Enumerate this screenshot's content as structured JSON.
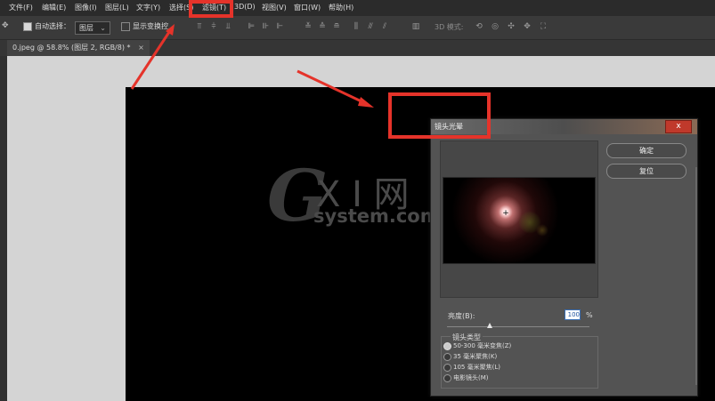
{
  "menu": {
    "items": [
      "文件(F)",
      "编辑(E)",
      "图像(I)",
      "图层(L)",
      "文字(Y)",
      "选择(S)",
      "滤镜(T)",
      "3D(D)",
      "视图(V)",
      "窗口(W)",
      "帮助(H)"
    ]
  },
  "options": {
    "auto_select_label": "自动选择：",
    "auto_select_checked": true,
    "layer_select_value": "图层",
    "show_transform_label": "显示变换控",
    "mode_3d_label": "3D 模式:"
  },
  "document": {
    "tab_title": "0.jpeg @ 58.8% (图层 2, RGB/8) *",
    "close_glyph": "×"
  },
  "watermark": {
    "logo_g": "G",
    "logo_xi": "X I 网",
    "logo_system": "system.com"
  },
  "dialog": {
    "title": "镜头光晕",
    "close_glyph": "x",
    "ok_label": "确定",
    "reset_label": "复位",
    "brightness_label": "亮度(B):",
    "brightness_value": "100",
    "brightness_unit": "%",
    "brightness_slider_fraction": 0.3,
    "lens_type_title": "镜头类型",
    "lens_types": [
      {
        "label": "50-300 毫米变焦(Z)",
        "selected": true
      },
      {
        "label": "35 毫米聚焦(K)",
        "selected": false
      },
      {
        "label": "105 毫米聚焦(L)",
        "selected": false
      },
      {
        "label": "电影镜头(M)",
        "selected": false
      }
    ]
  },
  "colors": {
    "highlight_red": "#e5332a"
  }
}
